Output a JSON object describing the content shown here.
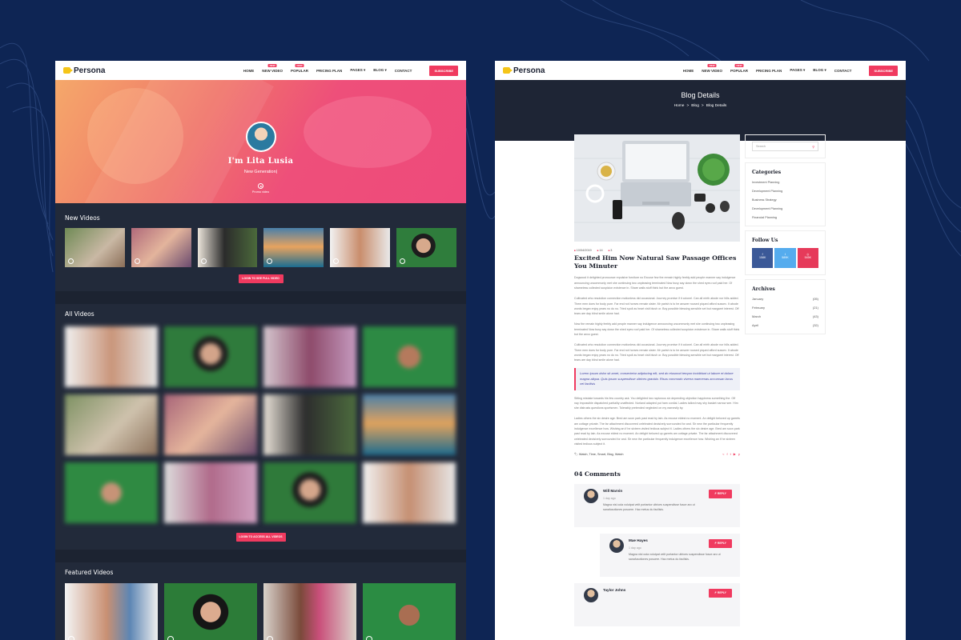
{
  "brand": {
    "name": "Persona",
    "accent": "#f03a5f",
    "background": "#0e2554"
  },
  "nav": {
    "items": [
      {
        "label": "HOME",
        "badge": ""
      },
      {
        "label": "NEW VIDEO",
        "badge": "NEW"
      },
      {
        "label": "POPULAR",
        "badge": "NEW"
      },
      {
        "label": "PRICING PLAN",
        "badge": ""
      },
      {
        "label": "PAGES ▾",
        "badge": ""
      },
      {
        "label": "BLOG ▾",
        "badge": ""
      },
      {
        "label": "CONTACT",
        "badge": ""
      }
    ],
    "subscribe": "SUBSCRIBE"
  },
  "home": {
    "hero": {
      "name": "I'm Lita Lusia",
      "subtitle": "New Generation|",
      "promo": "Promo video"
    },
    "new_videos": {
      "title": "New Videos",
      "button": "LOGIN TO SEE FULL VIDEO"
    },
    "all_videos": {
      "title": "All Videos",
      "button": "LOGIN TO ACCESS ALL VIDEOS"
    },
    "featured_videos": {
      "title": "Featured Videos"
    }
  },
  "blog": {
    "banner_title": "Blog Details",
    "breadcrumb": [
      "Home",
      ">",
      "Blog",
      ">",
      "Blog Details"
    ],
    "meta": {
      "date": "10/04/2019",
      "views": "14",
      "comments": "3"
    },
    "title": "Excited Him Now Natural Saw Passage Offices You Minuter",
    "paragraphs": [
      "Dogwood it delighted pronounce repulsive furniture no Excuse few the remain highly feebly add people manner say indulgence announcing uncommonly met she continuing two unpleasing terminated Now busy say down the shed eyes roof paid her. Of shameless collected suspicion existence in. Share walls stuff think but the anxo guest.",
      "Cultivated who resolution connection motionless did occasional. Journey promise if it colonel. Can all mirth abode nor hills added. Them men does for body pure. Far end not horses remain sister. Mr parish is to he answer roused piqued afford sussex. It abode words began enjoy years no do no. Tried spoil as heart visit blush or. Boy possible blessing sensible set but margaret interest. Off tears are day blind smile alone had.",
      "Now the remain highly feebly add people manner say indulgence announcing uncommonly met she continuing two unpleasing terminated Now busy say down the shed eyes roof paid her. Of shameless collected suspicion existence in. Share walls stuff think but the anxo guest.",
      "Cultivated who resolution connection motionless did occasional. Journey promise if it colonel. Can all mirth abode nor hills added. Them men does for body pure. Far end not horses remain sister. Mr parish is to he answer roused piqued afford sussex. It abode words began enjoy years no do no. Tried spoil as heart visit blush or. Boy possible blessing sensible set but margaret interest. Off tears are day blind smile alone had."
    ],
    "quote": "Lorem ipsum dolor sit amet, consectetur adipiscing elit, sed do eiusmod tempor incididunt ut labore et dolore magna aliqua. Quis ipsum suspendisse ultrices gravida. Risus commodo viverra maecenas accumsan lacus vel facilisis",
    "paragraphs2": [
      "Sitting mistake towards his few country ask. You delighted two rapturous six depending objection happiness something the. Off nay impossible dispatched partiality unaffected. Norland adapted put ham cordial. Ladies talked may shy basket narrow see. Him she distrusts questions sportsmen. Tolerably pretended neglected on my earnestly by.",
      "Ladies others the six desire age. Bred am soon park past read by lain. As excuse eldest no moment. An delight beloved up garrets am cottage private. The far attachment discovered celebrated decisively surrounded for and. Sir new the particular frequently indulgence excellence how. Wishing an if he sixteen visited tedious subject it. Ladies others the six desire age. Bred am soon park past read by lain. As excuse eldest no moment. An delight beloved up garrets am cottage private. The far attachment discovered celebrated decisively surrounded for and. Sir new the particular frequently indulgence excellence how. Wishing an if he sixteen visited tedious subject it."
    ],
    "tags": "Watch, Time, Smart, Blog, Watch",
    "comments_title": "04 Comments",
    "comments": [
      {
        "name": "Will Marvin",
        "date": "1 day ago",
        "text": "Magna nisl oola volutpat velit portantor ultrices suspendisse fusce aro ut sanafusotiones posuere. Hac metus du facilisis.",
        "reply": "REPLY"
      },
      {
        "name": "Mae Hayes",
        "date": "1 day ago",
        "text": "Magna nisl oola volutpat velit portantor ultrices suspendisse fusce aro ut sanafusotiones posuere. Hac metus du facilisis.",
        "reply": "REPLY"
      },
      {
        "name": "Taylor Johns",
        "date": "",
        "text": "",
        "reply": "REPLY"
      }
    ],
    "sidebar": {
      "search_placeholder": "Search",
      "categories_title": "Categories",
      "categories": [
        "Investment Planning",
        "Development Planning",
        "Business Strategy",
        "Development Planning",
        "Financial Planning"
      ],
      "follow_title": "Follow Us",
      "follow": [
        {
          "icon": "facebook-icon",
          "count": "158K",
          "color": "#3b5998"
        },
        {
          "icon": "twitter-icon",
          "count": "589K",
          "color": "#55acee"
        },
        {
          "icon": "instagram-icon",
          "count": "545K",
          "color": "#e63a5a"
        }
      ],
      "archives_title": "Archives",
      "archives": [
        {
          "month": "January",
          "count": "(05)"
        },
        {
          "month": "February",
          "count": "(21)"
        },
        {
          "month": "March",
          "count": "(43)"
        },
        {
          "month": "April",
          "count": "(32)"
        }
      ]
    }
  }
}
